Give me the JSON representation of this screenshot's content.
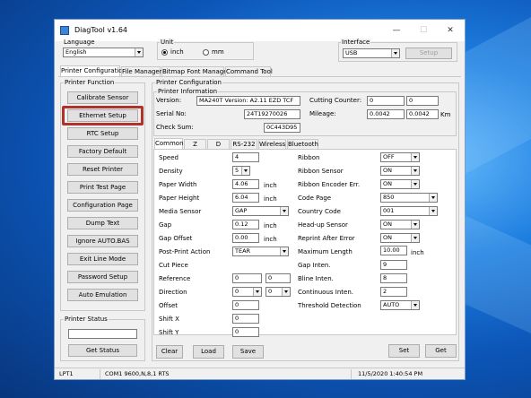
{
  "window": {
    "title": "DiagTool v1.64"
  },
  "language": {
    "label": "Language",
    "value": "English"
  },
  "unit": {
    "label": "Unit",
    "inch": "inch",
    "mm": "mm",
    "selected": "inch"
  },
  "interface": {
    "label": "Interface",
    "value": "USB",
    "setup": "Setup"
  },
  "main_tabs": [
    "Printer Configuration",
    "File Manager",
    "Bitmap Font Manager",
    "Command Tool"
  ],
  "printer_function": {
    "label": "Printer Function",
    "buttons": [
      "Calibrate Sensor",
      "Ethernet Setup",
      "RTC Setup",
      "Factory Default",
      "Reset Printer",
      "Print Test Page",
      "Configuration Page",
      "Dump Text",
      "Ignore AUTO.BAS",
      "Exit Line Mode",
      "Password Setup",
      "Auto Emulation"
    ]
  },
  "printer_status": {
    "label": "Printer Status",
    "value": "",
    "button": "Get Status"
  },
  "config": {
    "label": "Printer Configuration"
  },
  "info": {
    "label": "Printer Information",
    "version_label": "Version:",
    "version": "MA240T Version: A2.11 EZD TCF",
    "serial_label": "Serial No:",
    "serial": "24T19270026",
    "checksum_label": "Check Sum:",
    "checksum": "0C443D95",
    "cutting_label": "Cutting Counter:",
    "cutting1": "0",
    "cutting2": "0",
    "mileage_label": "Mileage:",
    "mileage1": "0.0042",
    "mileage2": "0.0042",
    "mileage_unit": "Km"
  },
  "sub_tabs": [
    "Common",
    "Z",
    "D",
    "RS-232",
    "Wireless",
    "Bluetooth"
  ],
  "left_fields": [
    {
      "label": "Speed",
      "value": "4"
    },
    {
      "label": "Density",
      "value": "5"
    },
    {
      "label": "Paper Width",
      "value": "4.06",
      "unit": "inch"
    },
    {
      "label": "Paper Height",
      "value": "6.04",
      "unit": "inch"
    },
    {
      "label": "Media Sensor",
      "value": "GAP"
    },
    {
      "label": "Gap",
      "value": "0.12",
      "unit": "inch"
    },
    {
      "label": "Gap Offset",
      "value": "0.00",
      "unit": "inch"
    },
    {
      "label": "Post-Print Action",
      "value": "TEAR"
    },
    {
      "label": "Cut Piece",
      "value": ""
    },
    {
      "label": "Reference",
      "value": "0",
      "value2": "0"
    },
    {
      "label": "Direction",
      "value": "0",
      "value2": "0"
    },
    {
      "label": "Offset",
      "value": "0"
    },
    {
      "label": "Shift X",
      "value": "0"
    },
    {
      "label": "Shift Y",
      "value": "0"
    }
  ],
  "right_fields": [
    {
      "label": "Ribbon",
      "value": "OFF"
    },
    {
      "label": "Ribbon Sensor",
      "value": "ON"
    },
    {
      "label": "Ribbon Encoder Err.",
      "value": "ON"
    },
    {
      "label": "Code Page",
      "value": "850"
    },
    {
      "label": "Country Code",
      "value": "001"
    },
    {
      "label": "Head-up Sensor",
      "value": "ON"
    },
    {
      "label": "Reprint After Error",
      "value": "ON"
    },
    {
      "label": "Maximum Length",
      "value": "10.00",
      "unit": "inch"
    },
    {
      "label": "Gap Inten.",
      "value": "9"
    },
    {
      "label": "Bline Inten.",
      "value": "8"
    },
    {
      "label": "Continuous Inten.",
      "value": "2"
    },
    {
      "label": "Threshold Detection",
      "value": "AUTO"
    }
  ],
  "bottom_buttons": {
    "clear": "Clear",
    "load": "Load",
    "save": "Save",
    "set": "Set",
    "get": "Get"
  },
  "status_bar": {
    "port": "LPT1",
    "comm": "COM1 9600,N,8,1 RTS",
    "datetime": "11/5/2020 1:40:54 PM"
  },
  "colors": {
    "highlight": "#b0332b",
    "desktop": "#0c56b8"
  }
}
